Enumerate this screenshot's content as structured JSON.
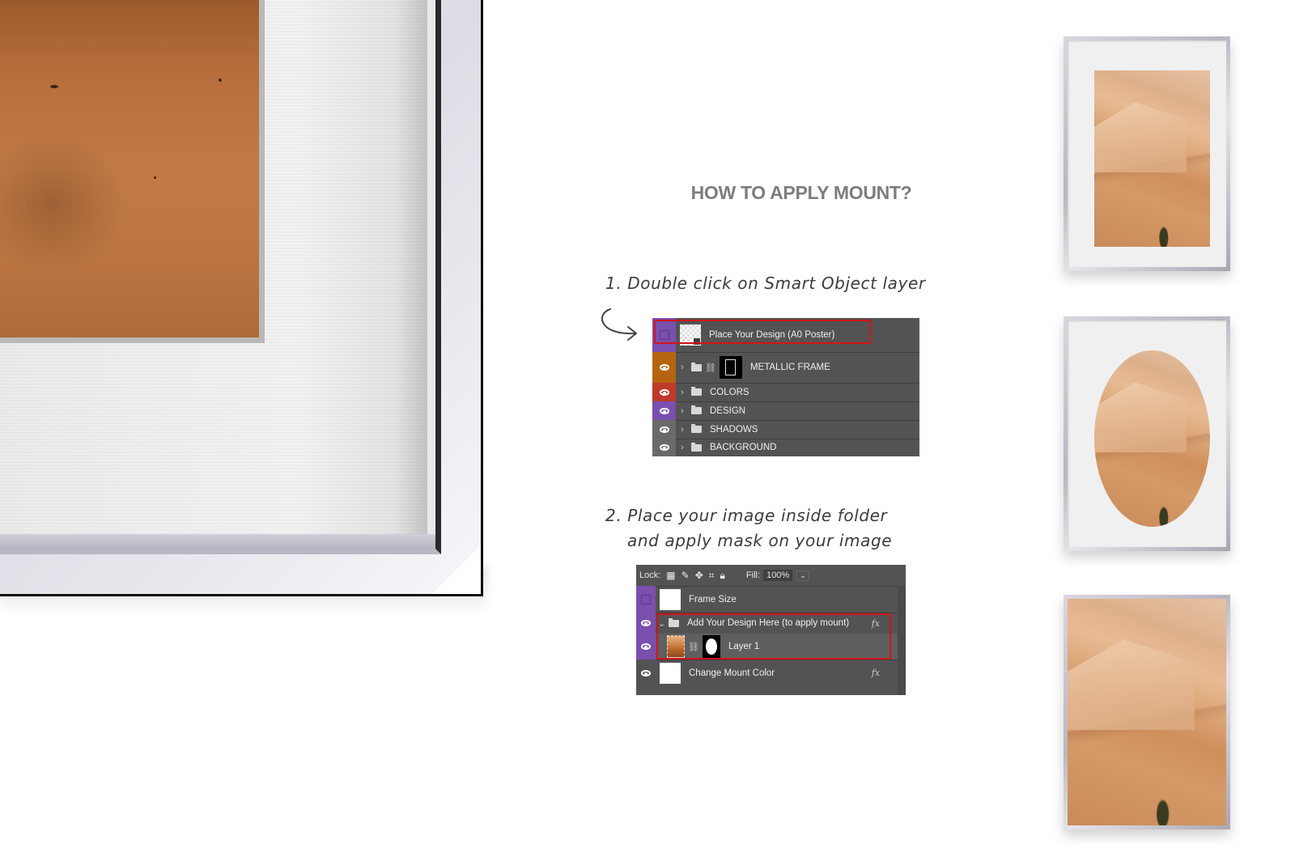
{
  "instructions": {
    "title": "HOW TO APPLY MOUNT?",
    "step1": "1. Double click on Smart Object layer",
    "step2_line1": "2. Place your image inside folder",
    "step2_line2": "and apply mask on your image"
  },
  "colors": {
    "highlight_border": "#d3141a",
    "panel_bg": "#535353",
    "tag_purple": "#7a4fae",
    "tag_orange": "#b5650f",
    "tag_red": "#c0392b",
    "tag_gray": "#6a6a6a"
  },
  "layers_panel_1": {
    "layers": [
      {
        "name": "Place Your Design (A0 Poster)",
        "tag": "purple",
        "visible": false,
        "type": "smart-object",
        "highlighted": true
      },
      {
        "name": "METALLIC FRAME",
        "tag": "orange",
        "visible": true,
        "type": "group-with-mask"
      },
      {
        "name": "COLORS",
        "tag": "red",
        "visible": true,
        "type": "group"
      },
      {
        "name": "DESIGN",
        "tag": "purple",
        "visible": true,
        "type": "group"
      },
      {
        "name": "SHADOWS",
        "tag": "gray",
        "visible": true,
        "type": "group"
      },
      {
        "name": "BACKGROUND",
        "tag": "gray",
        "visible": true,
        "type": "group"
      }
    ]
  },
  "layers_panel_2": {
    "lock_label": "Lock:",
    "fill_label": "Fill:",
    "fill_value": "100%",
    "layers": [
      {
        "name": "Frame Size",
        "tag": "purple",
        "visible": false
      },
      {
        "name": "Add Your Design Here (to apply mount)",
        "tag": "purple",
        "visible": true,
        "type": "group-open",
        "fx": "fx",
        "highlighted": true
      },
      {
        "name": "Layer 1",
        "tag": "purple",
        "visible": true,
        "type": "masked-layer",
        "highlighted": true
      },
      {
        "name": "Change Mount Color",
        "tag": "none",
        "visible": true,
        "fx": "fx"
      }
    ]
  },
  "previews": [
    {
      "label": "rectangular-mount"
    },
    {
      "label": "oval-mount"
    },
    {
      "label": "no-mount"
    }
  ]
}
